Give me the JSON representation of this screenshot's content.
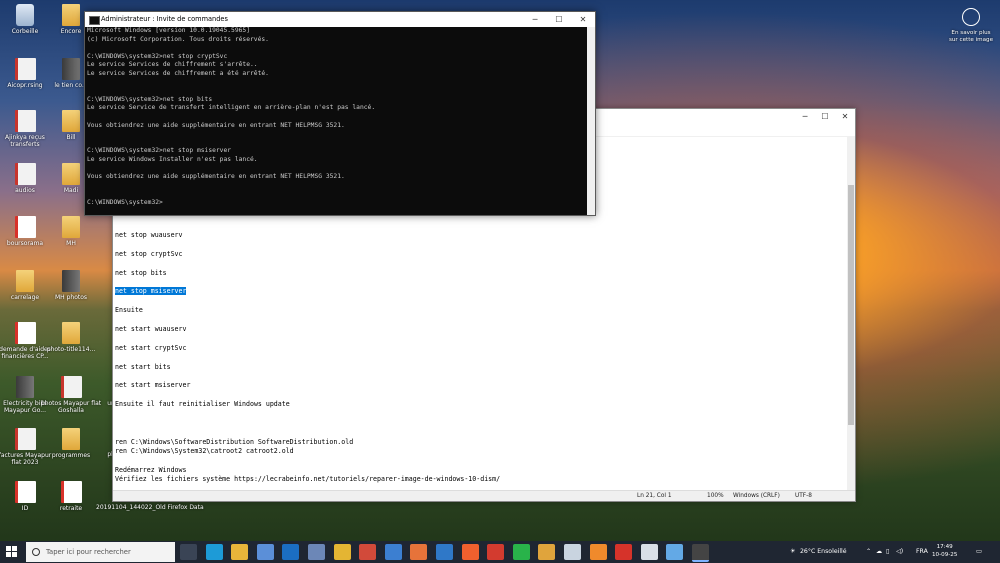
{
  "desktop_icons": [
    {
      "label": "Corbeille",
      "type": "bin"
    },
    {
      "label": "Encore",
      "type": "folder"
    },
    {
      "label": "Aicopr.rsing",
      "type": "doc"
    },
    {
      "label": "le tien co...",
      "type": "book"
    },
    {
      "label": "Ajinkya reçus transferts",
      "type": "doc"
    },
    {
      "label": "Bill",
      "type": "folder"
    },
    {
      "label": "audios",
      "type": "doc"
    },
    {
      "label": "Madi",
      "type": "folder"
    },
    {
      "label": "boursorama",
      "type": "pdf"
    },
    {
      "label": "MH",
      "type": "folder"
    },
    {
      "label": "carrelage",
      "type": "folder"
    },
    {
      "label": "MH photos",
      "type": "book"
    },
    {
      "label": "demande d'aides financières CP...",
      "type": "pdf"
    },
    {
      "label": "photo-title114...",
      "type": "folder"
    },
    {
      "label": "Electricity bills Mayapur Go...",
      "type": "book"
    },
    {
      "label": "photos Mayapur flat Goshalla",
      "type": "doc"
    },
    {
      "label": "factures Mayapur flat 2023",
      "type": "doc"
    },
    {
      "label": "programmes",
      "type": "folder"
    },
    {
      "label": "ID",
      "type": "pdf"
    },
    {
      "label": "retraite",
      "type": "pdf"
    }
  ],
  "extra_labels": {
    "un": "un",
    "pho": "pho",
    "firefox_data": "20191104_144022_Old Firefox Data"
  },
  "topright": {
    "label": "En savoir plus sur cette image"
  },
  "cmd": {
    "title": "Administrateur : Invite de commandes",
    "minimize": "─",
    "maximize": "☐",
    "close": "✕",
    "lines": [
      "Microsoft Windows [version 10.0.19045.5965]",
      "(c) Microsoft Corporation. Tous droits réservés.",
      "",
      "C:\\WINDOWS\\system32>net stop cryptSvc",
      "Le service Services de chiffrement s'arrête..",
      "Le service Services de chiffrement a été arrêté.",
      "",
      "",
      "C:\\WINDOWS\\system32>net stop bits",
      "Le service Service de transfert intelligent en arrière-plan n'est pas lancé.",
      "",
      "Vous obtiendrez une aide supplémentaire en entrant NET HELPMSG 3521.",
      "",
      "",
      "C:\\WINDOWS\\system32>net stop msiserver",
      "Le service Windows Installer n'est pas lancé.",
      "",
      "Vous obtiendrez une aide supplémentaire en entrant NET HELPMSG 3521.",
      "",
      "",
      "C:\\WINDOWS\\system32>"
    ]
  },
  "notepad": {
    "minimize": "─",
    "maximize": "☐",
    "close": "✕",
    "lines_before": [
      "net stop wuauserv",
      "",
      "net stop cryptSvc",
      "",
      "net stop bits",
      ""
    ],
    "selected_line": "net stop msiserver",
    "lines_after": [
      "",
      "Ensuite",
      "",
      "net start wuauserv",
      "",
      "net start cryptSvc",
      "",
      "net start bits",
      "",
      "net start msiserver",
      "",
      "Ensuite il faut reinitialiser Windows update",
      "",
      "",
      "",
      "ren C:\\Windows\\SoftwareDistribution SoftwareDistribution.old",
      "ren C:\\Windows\\System32\\catroot2 catroot2.old",
      "",
      "Redémarrez Windows",
      "Vérifiez les fichiers système https://lecrabeinfo.net/tutoriels/reparer-image-de-windows-10-dism/"
    ],
    "status": {
      "position": "Ln 21, Col 1",
      "zoom": "100%",
      "line_ending": "Windows (CRLF)",
      "encoding": "UTF-8"
    }
  },
  "taskbar": {
    "search_placeholder": "Taper ici pour rechercher",
    "apps": [
      "task-view",
      "edge",
      "file-explorer",
      "store",
      "outlook",
      "network",
      "chrome",
      "app-red",
      "app-blue",
      "app-orange",
      "app-ocean",
      "brave",
      "app-gmail",
      "whatsapp",
      "app-misc",
      "app-notes",
      "firefox",
      "acrobat",
      "paint",
      "onedrive",
      "terminal"
    ],
    "weather": "26°C Ensoleillé",
    "language": "FRA",
    "time": "17:49",
    "date": "10-09-25"
  }
}
